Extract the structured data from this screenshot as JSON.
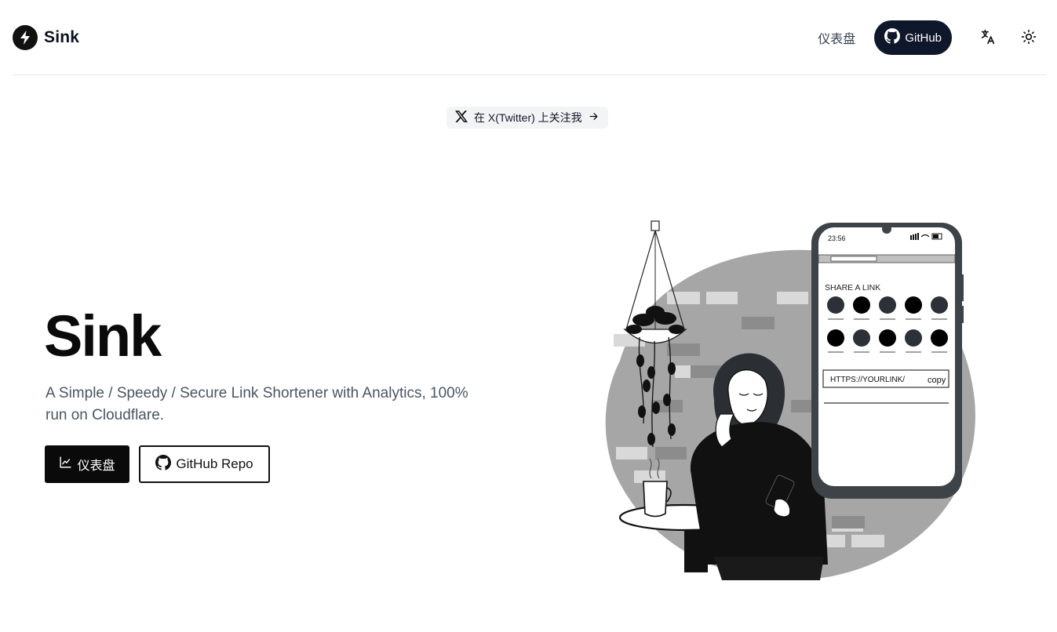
{
  "header": {
    "brand": "Sink",
    "nav_dashboard": "仪表盘",
    "github_label": "GitHub",
    "icons": {
      "logo": "bolt-icon",
      "github": "github-icon",
      "translate": "translate-icon",
      "theme": "sun-icon"
    }
  },
  "announcement": {
    "text": "在 X(Twitter) 上关注我",
    "icons": {
      "x": "x-logo-icon",
      "arrow": "arrow-right-icon"
    }
  },
  "hero": {
    "title": "Sink",
    "description": "A Simple / Speedy / Secure Link Shortener with Analytics, 100% run on Cloudflare.",
    "primary_button": "仪表盘",
    "secondary_button": "GitHub Repo",
    "icons": {
      "primary": "chart-icon",
      "secondary": "github-icon"
    }
  },
  "illustration": {
    "phone_time": "23:56",
    "share_heading": "SHARE A LINK",
    "link_placeholder": "HTTPS://YOURLINK/",
    "copy_label": "copy"
  },
  "colors": {
    "primary": "#0a0a0a",
    "accent_dark": "#0f172a",
    "blob": "#a6a6a6",
    "phone_frame": "#3d4347"
  }
}
